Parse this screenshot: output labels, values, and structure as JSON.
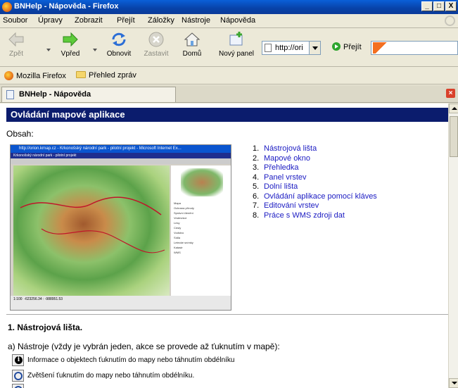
{
  "window": {
    "title": "BNHelp - Nápověda - Firefox",
    "buttons": [
      "_",
      "□",
      "X"
    ]
  },
  "menu": [
    "Soubor",
    "Úpravy",
    "Zobrazit",
    "Přejít",
    "Záložky",
    "Nástroje",
    "Nápověda"
  ],
  "toolbar": {
    "back": "Zpět",
    "forward": "Vpřed",
    "reload": "Obnovit",
    "stop": "Zastavit",
    "home": "Domů",
    "new_panel": "Nový panel",
    "url": "http://ori",
    "go": "Přejít"
  },
  "bookmarks": [
    "Mozilla Firefox",
    "Přehled zpráv"
  ],
  "tab": {
    "label": "BNHelp - Nápověda"
  },
  "page": {
    "heading": "Ovládání mapové aplikace",
    "obsah": "Obsah:",
    "toc": [
      {
        "num": "1.",
        "label": "Nástrojová lišta"
      },
      {
        "num": "2.",
        "label": "Mapové okno"
      },
      {
        "num": "3.",
        "label": "Přehledka"
      },
      {
        "num": "4.",
        "label": "Panel vrstev"
      },
      {
        "num": "5.",
        "label": "Dolní lišta"
      },
      {
        "num": "6.",
        "label": "Ovládání aplikace pomocí kláves"
      },
      {
        "num": "7.",
        "label": "Editování vrstev"
      },
      {
        "num": "8.",
        "label": "Práce s WMS zdroji dat"
      }
    ],
    "section_title": "1. Nástrojová lišta.",
    "paragraph": "a) Nástroje (vždy je vybrán jeden, akce se provede až ťuknutím v mapě):",
    "tools": [
      "Informace o objektech ťuknutím do mapy nebo táhnutím obdélníku",
      "Zvětšení ťuknutím do mapy nebo táhnutím obdélníku."
    ],
    "screenshot": {
      "title": "http://orion.krnap.cz - Krkonošský národní park - pilotní projekt - Microsoft Internet Ex...",
      "subtitle": "Krkonošský národní park - pilotní projekt",
      "layers": [
        "Mapa",
        "Ochrana přírody",
        "Správní členění",
        "Vrstevnice",
        "Lesy",
        "Cesty",
        "Vodstvo",
        "Sídla",
        "Letecké snímky",
        "Katastr",
        "WMS"
      ],
      "status_left": "1:100",
      "status_coords": "-623256.34 : -988951.53"
    }
  }
}
